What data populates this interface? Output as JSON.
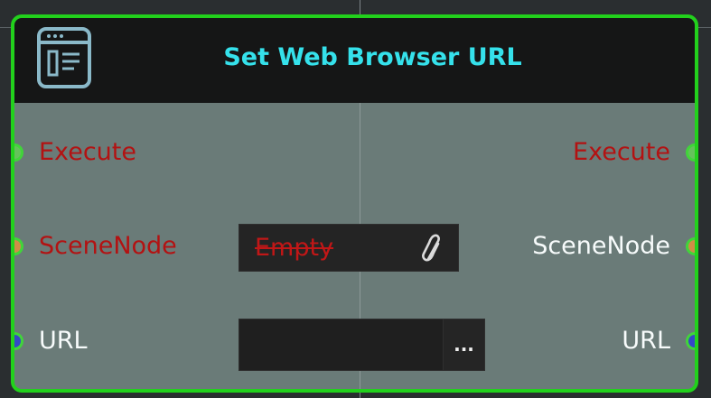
{
  "node": {
    "title": "Set Web Browser URL",
    "title_color": "#35e1eb",
    "border_color": "#22d11c",
    "header_icon": "web-browser-icon"
  },
  "inputs": [
    {
      "label": "Execute",
      "pin": "exec",
      "color": "#b31212"
    },
    {
      "label": "SceneNode",
      "pin": "object",
      "color": "#b31212"
    },
    {
      "label": "URL",
      "pin": "string",
      "color": "#f7fbfb"
    }
  ],
  "outputs": [
    {
      "label": "Execute",
      "pin": "exec",
      "color": "#b31212"
    },
    {
      "label": "SceneNode",
      "pin": "object",
      "color": "#f7fbfb"
    },
    {
      "label": "URL",
      "pin": "string",
      "color": "#f7fbfb"
    }
  ],
  "fields": {
    "scene_node": {
      "value": "Empty",
      "icon": "paperclip-icon"
    },
    "url": {
      "value": "",
      "placeholder": "",
      "button_label": "..."
    }
  }
}
